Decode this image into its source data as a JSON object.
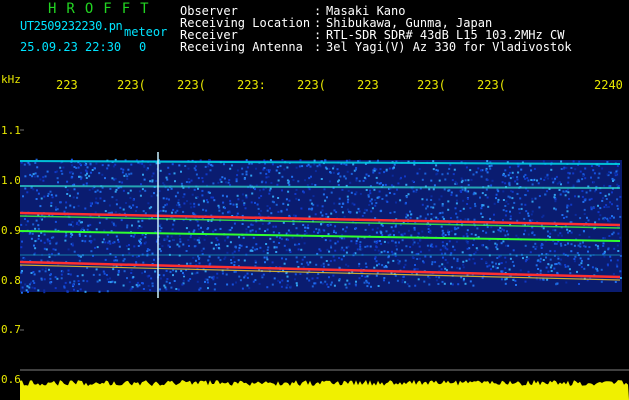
{
  "app_title": "HROFFT",
  "file_name": "UT2509232230.pn",
  "mode_label": "meteor",
  "timestamp": "25.09.23 22:30",
  "counter": "0",
  "info": [
    {
      "label": "Observer",
      "value": "Masaki Kano"
    },
    {
      "label": "Receiving Location",
      "value": "Shibukawa, Gunma, Japan"
    },
    {
      "label": "Receiver",
      "value": "RTL-SDR SDR# 43dB L15 103.2MHz CW"
    },
    {
      "label": "Receiving Antenna",
      "value": "3el Yagi(V) Az 330 for Vladivostok"
    }
  ],
  "info_colon": ":",
  "unit_label": "kHz",
  "time_ticks": [
    "223",
    "223(",
    "223(",
    "223:",
    "223(",
    "223",
    "223(",
    "223(",
    "2240"
  ],
  "freq_ticks": [
    "1.1",
    "1.0",
    "0.9",
    "0.8",
    "0.7",
    "0.6"
  ],
  "colors": {
    "background": "#000000",
    "noise": "#1030c0",
    "signal": "#ff4030",
    "amplitude": "#f0f000",
    "header_text": "#00e4ff",
    "tick_text": "#e8e800"
  }
}
